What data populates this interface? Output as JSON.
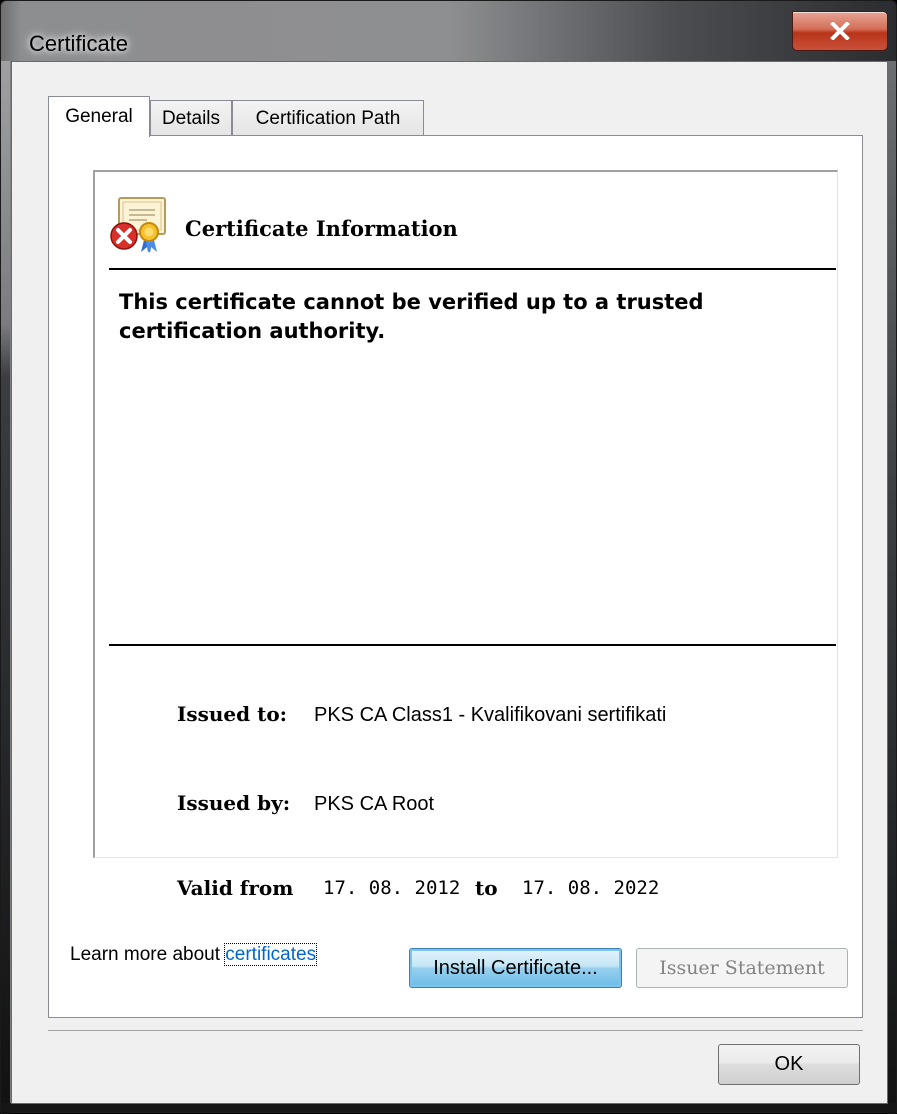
{
  "window": {
    "title": "Certificate",
    "close_label": "x"
  },
  "tabs": [
    {
      "label": "General",
      "active": true
    },
    {
      "label": "Details",
      "active": false
    },
    {
      "label": "Certification Path",
      "active": false
    }
  ],
  "info": {
    "icon": "certificate-error-icon",
    "heading": "Certificate Information",
    "warning_line1": "This certificate cannot be verified up to a trusted",
    "warning_line2": "certification authority.",
    "issued_to_label": "Issued to:",
    "issued_to_value": "PKS CA Class1 - Kvalifikovani sertifikati",
    "issued_by_label": "Issued by:",
    "issued_by_value": "PKS CA Root",
    "valid_from_label": "Valid from",
    "valid_from_value": "17. 08. 2012",
    "valid_to_label": "to",
    "valid_to_value": "17. 08. 2022"
  },
  "buttons": {
    "install": "Install Certificate...",
    "issuer_statement": "Issuer Statement",
    "ok": "OK"
  },
  "learn_more": {
    "prefix": "Learn more about ",
    "link": "certificates"
  },
  "colors": {
    "link": "#0066cc",
    "close_button": "#c9503a",
    "default_button": "#98d1ef"
  }
}
